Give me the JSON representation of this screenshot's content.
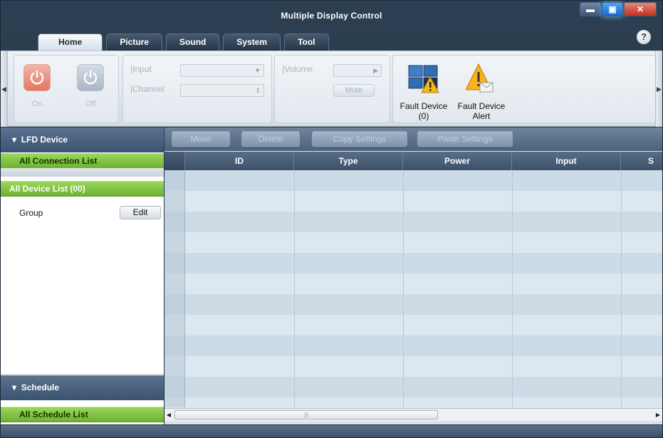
{
  "window": {
    "title": "Multiple Display Control",
    "controls": {
      "minimize": "▬",
      "maximize": "▣",
      "close": "✕"
    }
  },
  "tabs": [
    "Home",
    "Picture",
    "Sound",
    "System",
    "Tool"
  ],
  "active_tab": "Home",
  "help_label": "?",
  "ribbon": {
    "power": {
      "on_label": "On",
      "off_label": "Off"
    },
    "input_label": "Input",
    "channel_label": "Channel",
    "volume_label": "Volume",
    "mute_label": "Mute",
    "fault_device_label": "Fault Device",
    "fault_device_count": "(0)",
    "fault_alert_label_1": "Fault Device",
    "fault_alert_label_2": "Alert"
  },
  "sidebar": {
    "lfd_header": "LFD Device",
    "all_connection_list": "All Connection List",
    "all_device_list": "All Device List (00)",
    "group_label": "Group",
    "edit_label": "Edit",
    "schedule_header": "Schedule",
    "all_schedule_list": "All Schedule List"
  },
  "actions": {
    "move": "Move",
    "delete": "Delete",
    "copy_settings": "Copy Settings",
    "paste_settings": "Paste Settings"
  },
  "table": {
    "columns": [
      "ID",
      "Type",
      "Power",
      "Input",
      "S"
    ],
    "rows": []
  },
  "colors": {
    "accent_green": "#7cc23f",
    "header_blue": "#4b627d",
    "power_on": "#e07763"
  }
}
